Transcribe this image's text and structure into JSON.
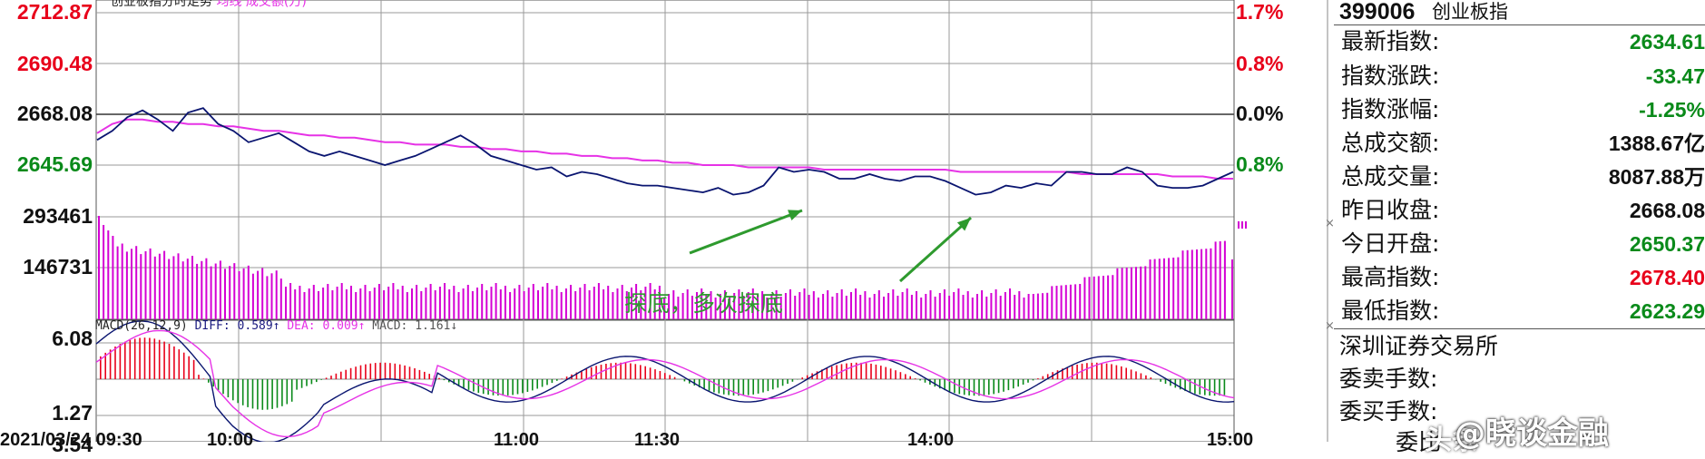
{
  "chart_header": {
    "title": "创业板指分时走势",
    "series_avg": "均线",
    "series_vol": "成交额(万)"
  },
  "price_axis_left": [
    "2712.87",
    "2690.48",
    "2668.08",
    "2645.69"
  ],
  "price_axis_right": [
    "1.7%",
    "0.8%",
    "0.0%",
    "0.8%"
  ],
  "volume_axis_left": [
    "293461",
    "146731"
  ],
  "macd_axis_left": [
    "6.08",
    "1.27",
    "3.54"
  ],
  "macd_header": {
    "name": "MACD(26,12,9)",
    "diff": "DIFF: 0.589↑",
    "dea": "DEA: 0.009↑",
    "macd": "MACD: 1.161↓"
  },
  "annotation": {
    "text": "探底，多次探底",
    "color": "#2e9a2e"
  },
  "time_axis": [
    "2021/03/24 09:30",
    "10:00",
    "11:00",
    "11:30",
    "14:00",
    "15:00"
  ],
  "colors": {
    "price_line": "#0a1570",
    "avg_line": "#e632e6",
    "volume_bar": "#d400d4",
    "grid": "#9a9a9a",
    "up": "#e8001a",
    "down": "#0a8a1a"
  },
  "panel": {
    "code": "399006",
    "name": "创业板指",
    "rows": [
      {
        "label": "最新指数:",
        "value": "2634.61",
        "color": "green"
      },
      {
        "label": "指数涨跌:",
        "value": "-33.47",
        "color": "green"
      },
      {
        "label": "指数涨幅:",
        "value": "-1.25%",
        "color": "green"
      },
      {
        "label": "总成交额:",
        "value": "1388.67亿",
        "color": "black"
      },
      {
        "label": "总成交量:",
        "value": "8087.88万",
        "color": "black"
      },
      {
        "label": "昨日收盘:",
        "value": "2668.08",
        "color": "black"
      },
      {
        "label": "今日开盘:",
        "value": "2650.37",
        "color": "green"
      },
      {
        "label": "最高指数:",
        "value": "2678.40",
        "color": "red"
      },
      {
        "label": "最低指数:",
        "value": "2623.29",
        "color": "green"
      }
    ],
    "exchange": "深圳证券交易所",
    "extra_rows": [
      "委卖手数:",
      "委买手数:",
      "委比"
    ]
  },
  "watermark": {
    "prefix": "头条",
    "text": "@晓谈金融"
  },
  "chart_data": {
    "type": "line",
    "title": "创业板指分时走势",
    "x_range": [
      "09:30",
      "15:00"
    ],
    "y_range": [
      2623.29,
      2712.87
    ],
    "prev_close": 2668.08,
    "series": [
      {
        "name": "创业板指",
        "values": [
          2657,
          2661,
          2667,
          2670,
          2666,
          2661,
          2669,
          2671,
          2664,
          2661,
          2656,
          2658,
          2660,
          2656,
          2652,
          2650,
          2652,
          2650,
          2648,
          2646,
          2648,
          2650,
          2653,
          2656,
          2659,
          2655,
          2650,
          2648,
          2646,
          2644,
          2645,
          2641,
          2643,
          2642,
          2640,
          2638,
          2637,
          2637,
          2636,
          2635,
          2634,
          2636,
          2633,
          2634,
          2637,
          2645,
          2643,
          2644,
          2643,
          2640,
          2640,
          2642,
          2640,
          2639,
          2641,
          2641,
          2639,
          2636,
          2633,
          2634,
          2637,
          2636,
          2638,
          2637,
          2643,
          2643,
          2642,
          2642,
          2645,
          2643,
          2637,
          2636,
          2636,
          2637,
          2640,
          2643
        ]
      },
      {
        "name": "均线",
        "values": [
          2660,
          2664,
          2666,
          2666,
          2665,
          2665,
          2664,
          2664,
          2663,
          2663,
          2662,
          2661,
          2661,
          2660,
          2659,
          2659,
          2658,
          2658,
          2657,
          2656,
          2656,
          2655,
          2655,
          2655,
          2654,
          2654,
          2653,
          2653,
          2652,
          2652,
          2651,
          2651,
          2650,
          2650,
          2649,
          2649,
          2648,
          2648,
          2647,
          2647,
          2646,
          2646,
          2646,
          2645,
          2645,
          2645,
          2645,
          2645,
          2644,
          2644,
          2644,
          2644,
          2644,
          2644,
          2644,
          2644,
          2644,
          2643,
          2643,
          2643,
          2643,
          2643,
          2643,
          2643,
          2643,
          2642,
          2642,
          2642,
          2642,
          2642,
          2642,
          2641,
          2641,
          2641,
          2640,
          2640
        ]
      }
    ]
  }
}
